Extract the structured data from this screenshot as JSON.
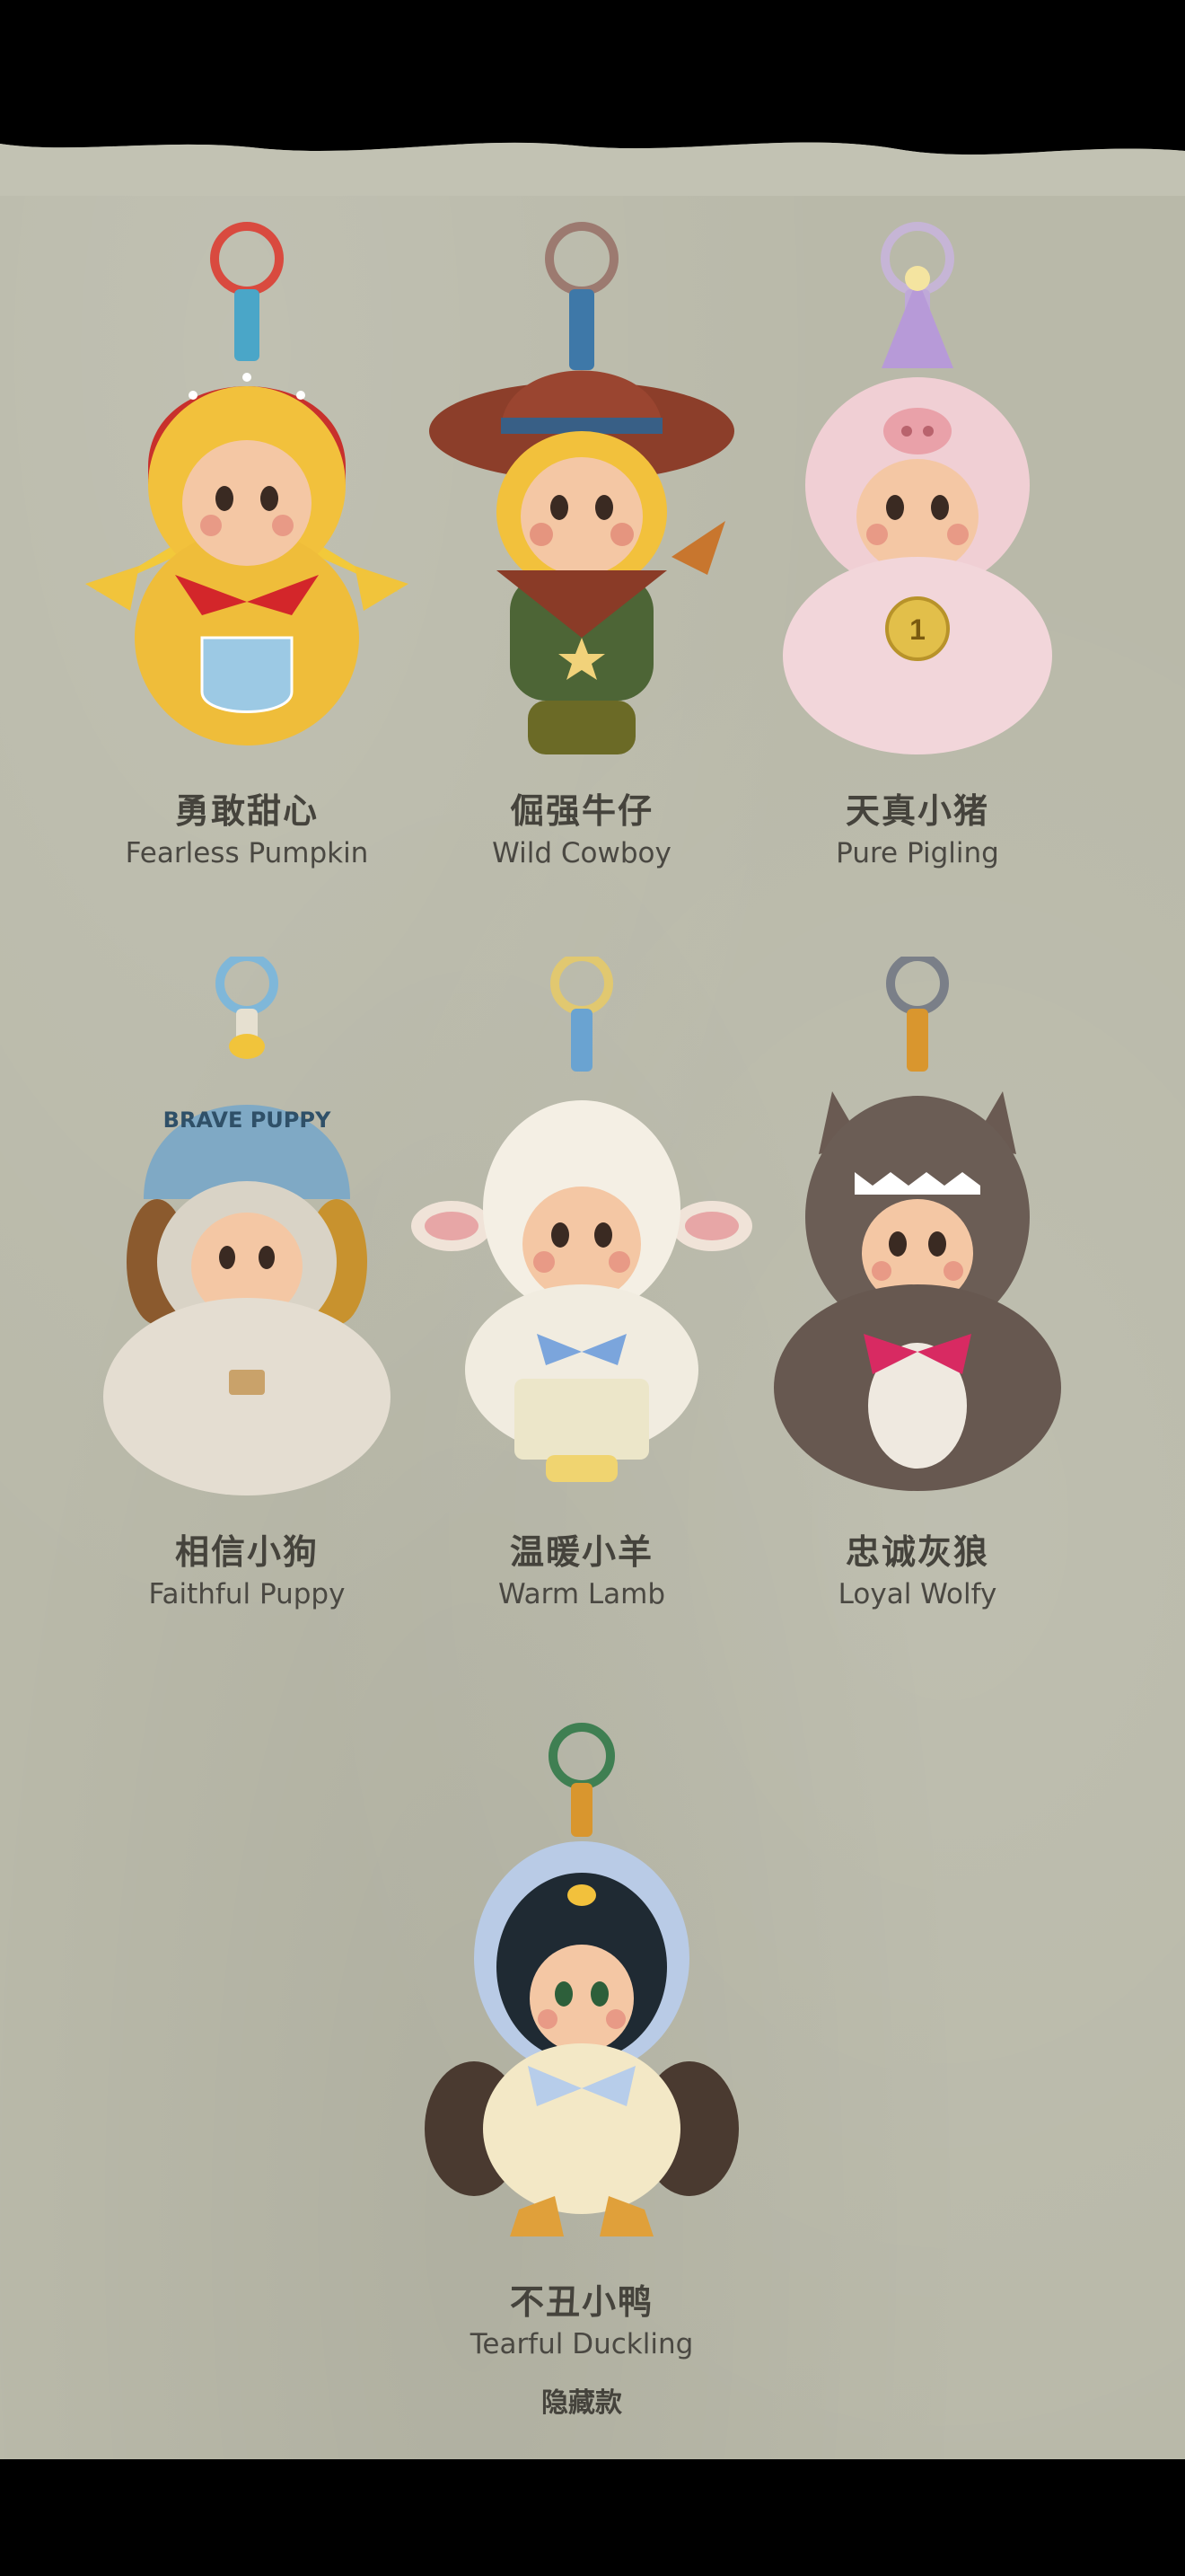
{
  "products": [
    {
      "cn": "勇敢甜心",
      "en": "Fearless Pumpkin"
    },
    {
      "cn": "倔强牛仔",
      "en": "Wild Cowboy"
    },
    {
      "cn": "天真小猪",
      "en": "Pure Pigling"
    },
    {
      "cn": "相信小狗",
      "en": "Faithful Puppy"
    },
    {
      "cn": "温暖小羊",
      "en": "Warm Lamb"
    },
    {
      "cn": "忠诚灰狼",
      "en": "Loyal Wolfy"
    },
    {
      "cn": "不丑小鸭",
      "en": "Tearful Duckling",
      "tag": "隐藏款"
    }
  ],
  "hat_text": "BRAVE PUPPY",
  "medal_text": "1",
  "colors": {
    "background": "#b9b9a9",
    "title": "#45433c",
    "subtitle": "#4a4842"
  }
}
